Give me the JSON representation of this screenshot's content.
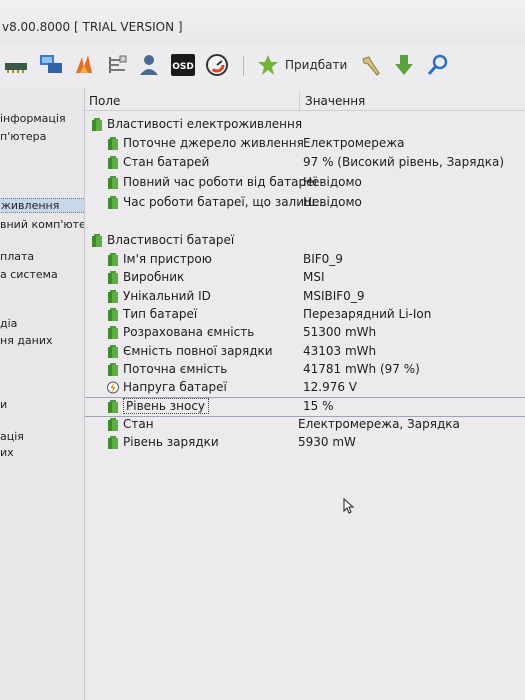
{
  "window": {
    "title": "v8.00.8000  [ TRIAL VERSION ]"
  },
  "toolbar": {
    "add_label": "Придбати",
    "osd_label": "OSD"
  },
  "sidebar": {
    "items": [
      {
        "label": "інформація"
      },
      {
        "label": "п'ютера"
      },
      {
        "label": "живлення"
      },
      {
        "label": "вний комп'юте"
      },
      {
        "label": "плата"
      },
      {
        "label": "а система"
      },
      {
        "label": "діа"
      },
      {
        "label": "ня даних"
      },
      {
        "label": "и"
      },
      {
        "label": "ація"
      },
      {
        "label": "их"
      }
    ]
  },
  "columns": {
    "field": "Поле",
    "value": "Значення"
  },
  "groups": {
    "power": {
      "title": "Властивості електроживлення",
      "rows": [
        {
          "label": "Поточне джерело живлення",
          "value": "Електромережа"
        },
        {
          "label": "Стан батарей",
          "value": "97 % (Високий рівень, Зарядка)"
        },
        {
          "label": "Повний час роботи від батареї",
          "value": "Невідомо"
        },
        {
          "label": "Час роботи батареї, що залиш...",
          "value": "Невідомо"
        }
      ]
    },
    "battery": {
      "title": "Властивості батареї",
      "rows": [
        {
          "label": "Ім'я пристрою",
          "value": "BIF0_9"
        },
        {
          "label": "Виробник",
          "value": "MSI"
        },
        {
          "label": "Унікальний ID",
          "value": "MSIBIF0_9"
        },
        {
          "label": "Тип батареї",
          "value": "Перезарядний Li-Ion"
        },
        {
          "label": "Розрахована ємність",
          "value": "51300 mWh"
        },
        {
          "label": "Ємність повної зарядки",
          "value": "43103 mWh"
        },
        {
          "label": "Поточна ємність",
          "value": "41781 mWh  (97 %)"
        },
        {
          "label": "Напруга батареї",
          "value": "12.976 V"
        },
        {
          "label": "Рівень зносу",
          "value": "15 %"
        },
        {
          "label": "Стан",
          "value": "Електромережа, Зарядка"
        },
        {
          "label": "Рівень зарядки",
          "value": "5930 mW"
        }
      ]
    }
  },
  "colors": {
    "battery_green": "#4f9a3a",
    "selection": "#c9d7ea"
  }
}
